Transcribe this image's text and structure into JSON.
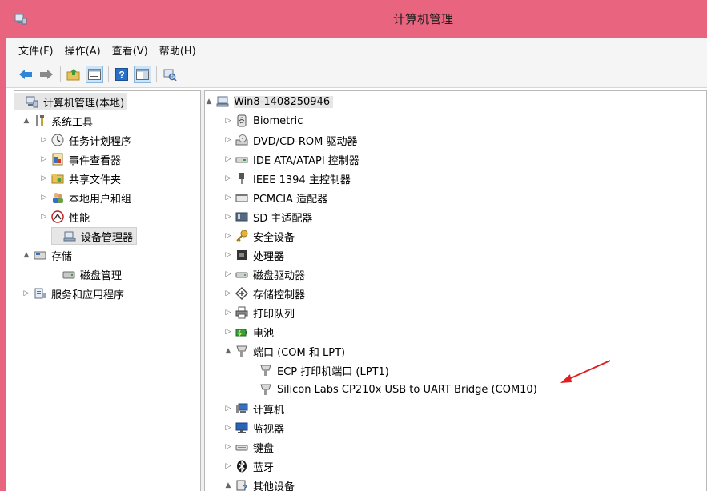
{
  "window": {
    "title": "计算机管理"
  },
  "menu": [
    "文件(F)",
    "操作(A)",
    "查看(V)",
    "帮助(H)"
  ],
  "toolbar": {
    "buttons": [
      "back-arrow-icon",
      "forward-arrow-icon",
      "up-folder-icon",
      "properties-icon",
      "help-icon",
      "show-hide-pane-icon",
      "scan-hardware-icon"
    ]
  },
  "left_tree": [
    {
      "label": "计算机管理(本地)",
      "icon": "computer-management-icon",
      "expander": ""
    },
    {
      "label": "系统工具",
      "icon": "tools-icon",
      "expander": "▲"
    },
    {
      "label": "任务计划程序",
      "icon": "clock-icon",
      "expander": "▷"
    },
    {
      "label": "事件查看器",
      "icon": "event-viewer-icon",
      "expander": "▷"
    },
    {
      "label": "共享文件夹",
      "icon": "shared-folder-icon",
      "expander": "▷"
    },
    {
      "label": "本地用户和组",
      "icon": "users-icon",
      "expander": "▷"
    },
    {
      "label": "性能",
      "icon": "performance-icon",
      "expander": "▷"
    },
    {
      "label": "设备管理器",
      "icon": "device-manager-icon",
      "expander": ""
    },
    {
      "label": "存储",
      "icon": "storage-icon",
      "expander": "▲"
    },
    {
      "label": "磁盘管理",
      "icon": "disk-icon",
      "expander": ""
    },
    {
      "label": "服务和应用程序",
      "icon": "services-icon",
      "expander": "▷"
    }
  ],
  "right_tree": [
    {
      "label": "Win8-1408250946",
      "icon": "computer-icon",
      "expander": "▲"
    },
    {
      "label": "Biometric",
      "icon": "biometric-icon",
      "expander": "▷"
    },
    {
      "label": "DVD/CD-ROM 驱动器",
      "icon": "dvd-drive-icon",
      "expander": "▷"
    },
    {
      "label": "IDE ATA/ATAPI 控制器",
      "icon": "ide-controller-icon",
      "expander": "▷"
    },
    {
      "label": "IEEE 1394 主控制器",
      "icon": "ieee1394-icon",
      "expander": "▷"
    },
    {
      "label": "PCMCIA 适配器",
      "icon": "pcmcia-icon",
      "expander": "▷"
    },
    {
      "label": "SD 主适配器",
      "icon": "sd-adapter-icon",
      "expander": "▷"
    },
    {
      "label": "安全设备",
      "icon": "security-key-icon",
      "expander": "▷"
    },
    {
      "label": "处理器",
      "icon": "processor-icon",
      "expander": "▷"
    },
    {
      "label": "磁盘驱动器",
      "icon": "disk-drive-icon",
      "expander": "▷"
    },
    {
      "label": "存储控制器",
      "icon": "storage-controller-icon",
      "expander": "▷"
    },
    {
      "label": "打印队列",
      "icon": "printer-icon",
      "expander": "▷"
    },
    {
      "label": "电池",
      "icon": "battery-icon",
      "expander": "▷"
    },
    {
      "label": "端口 (COM 和 LPT)",
      "icon": "port-icon",
      "expander": "▲"
    },
    {
      "label": "ECP 打印机端口 (LPT1)",
      "icon": "port-icon",
      "expander": ""
    },
    {
      "label": "Silicon Labs CP210x USB to UART Bridge (COM10)",
      "icon": "port-icon",
      "expander": ""
    },
    {
      "label": "计算机",
      "icon": "computer-icon",
      "expander": "▷"
    },
    {
      "label": "监视器",
      "icon": "monitor-icon",
      "expander": "▷"
    },
    {
      "label": "键盘",
      "icon": "keyboard-icon",
      "expander": "▷"
    },
    {
      "label": "蓝牙",
      "icon": "bluetooth-icon",
      "expander": "▷"
    },
    {
      "label": "其他设备",
      "icon": "other-devices-icon",
      "expander": "▲"
    }
  ],
  "colors": {
    "titlebar": "#e8647f",
    "annotation_arrow": "#e02020"
  }
}
